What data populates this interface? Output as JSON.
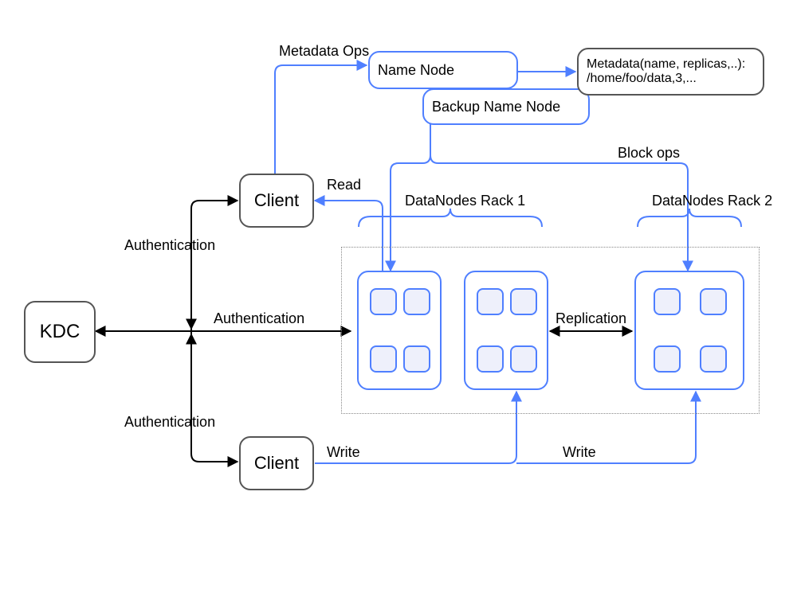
{
  "nodes": {
    "kdc": "KDC",
    "nameNode": "Name Node",
    "backupNameNode": "Backup Name Node",
    "client1": "Client",
    "client2": "Client",
    "metadataLine1": "Metadata(name, replicas,..):",
    "metadataLine2": "/home/foo/data,3,..."
  },
  "labels": {
    "metadataOps": "Metadata Ops",
    "blockOps": "Block ops",
    "read": "Read",
    "write1": "Write",
    "write2": "Write",
    "replication": "Replication",
    "auth1": "Authentication",
    "auth2": "Authentication",
    "auth3": "Authentication",
    "rack1": "DataNodes Rack 1",
    "rack2": "DataNodes Rack 2"
  }
}
